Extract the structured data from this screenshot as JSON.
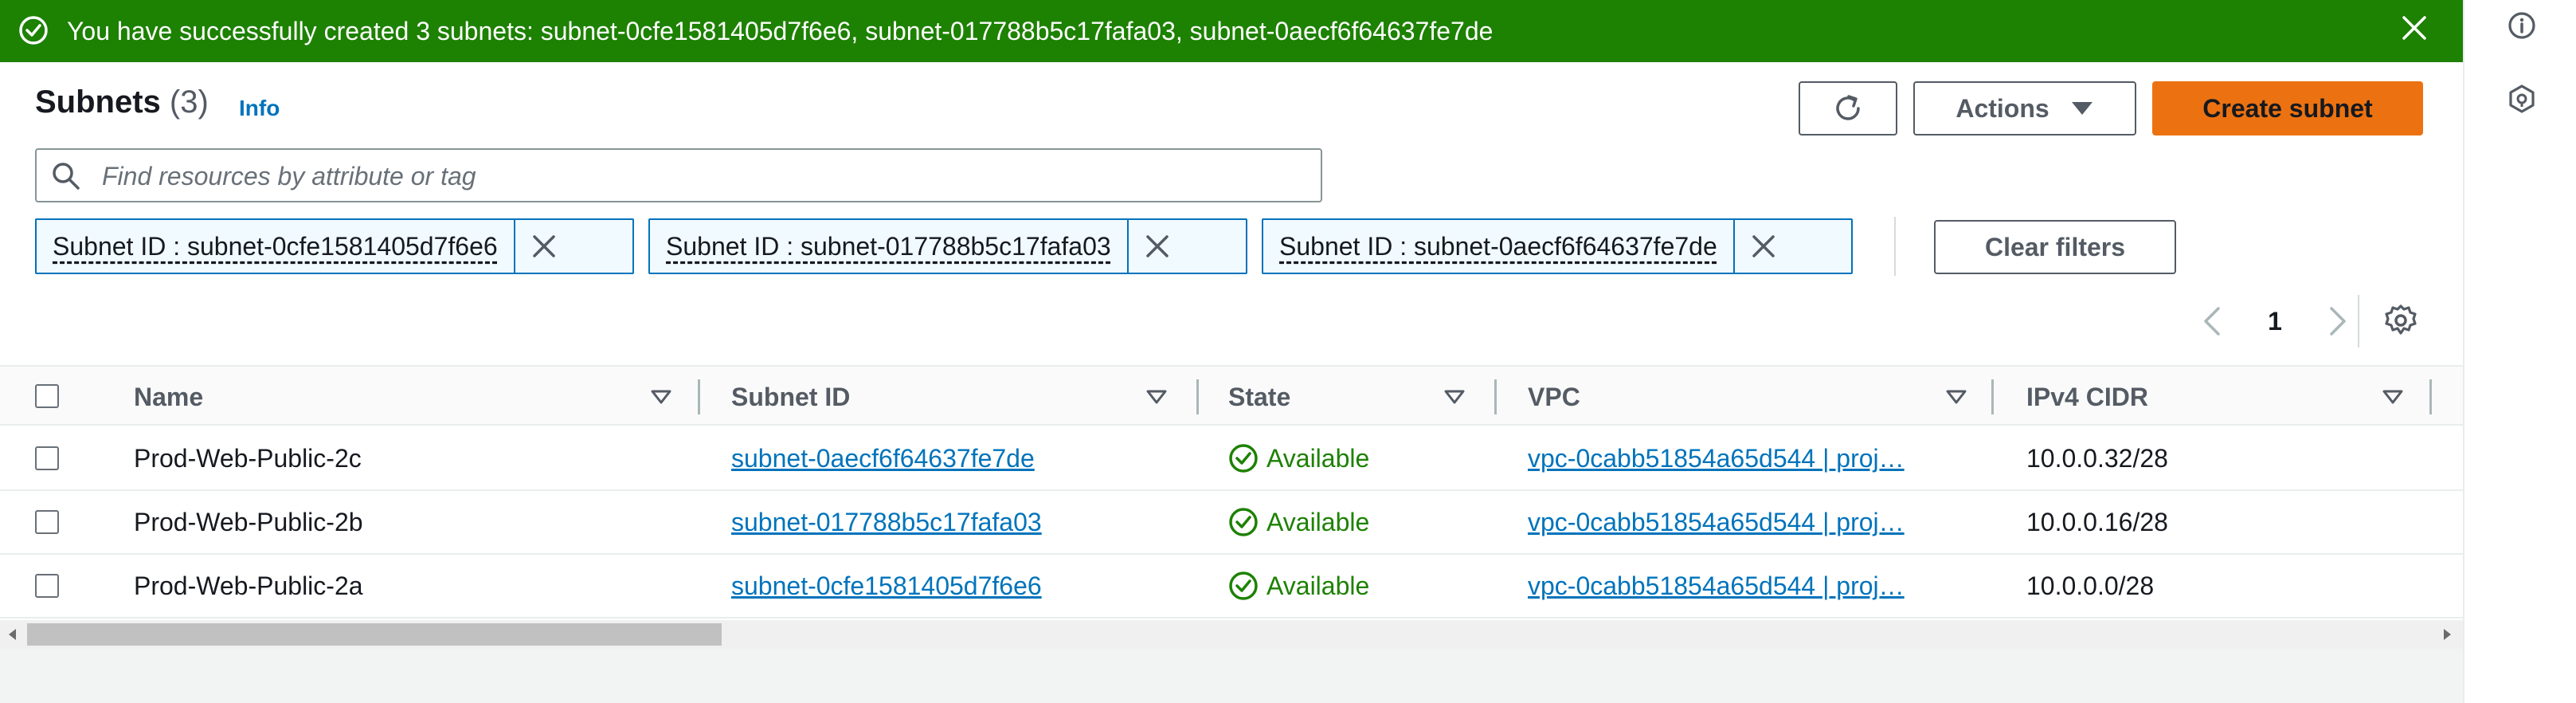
{
  "banner": {
    "message": "You have successfully created 3 subnets: subnet-0cfe1581405d7f6e6, subnet-017788b5c17fafa03, subnet-0aecf6f64637fe7de",
    "status_color": "#1d8102"
  },
  "header": {
    "title": "Subnets",
    "count": "(3)",
    "info_label": "Info",
    "actions_label": "Actions",
    "create_label": "Create subnet",
    "refresh_icon": "refresh-icon"
  },
  "search": {
    "placeholder": "Find resources by attribute or tag"
  },
  "filters": {
    "tokens": [
      "Subnet ID : subnet-0cfe1581405d7f6e6",
      "Subnet ID : subnet-017788b5c17fafa03",
      "Subnet ID : subnet-0aecf6f64637fe7de"
    ],
    "clear_label": "Clear filters"
  },
  "pagination": {
    "current_page": "1"
  },
  "table": {
    "columns": [
      "Name",
      "Subnet ID",
      "State",
      "VPC",
      "IPv4 CIDR"
    ],
    "rows": [
      {
        "name": "Prod-Web-Public-2c",
        "subnet_id": "subnet-0aecf6f64637fe7de",
        "state": "Available",
        "vpc": "vpc-0cabb51854a65d544 | proj…",
        "cidr": "10.0.0.32/28"
      },
      {
        "name": "Prod-Web-Public-2b",
        "subnet_id": "subnet-017788b5c17fafa03",
        "state": "Available",
        "vpc": "vpc-0cabb51854a65d544 | proj…",
        "cidr": "10.0.0.16/28"
      },
      {
        "name": "Prod-Web-Public-2a",
        "subnet_id": "subnet-0cfe1581405d7f6e6",
        "state": "Available",
        "vpc": "vpc-0cabb51854a65d544 | proj…",
        "cidr": "10.0.0.0/28"
      }
    ]
  },
  "colors": {
    "accent": "#0073bb",
    "primary_button": "#ec7211",
    "success": "#1d8102"
  }
}
